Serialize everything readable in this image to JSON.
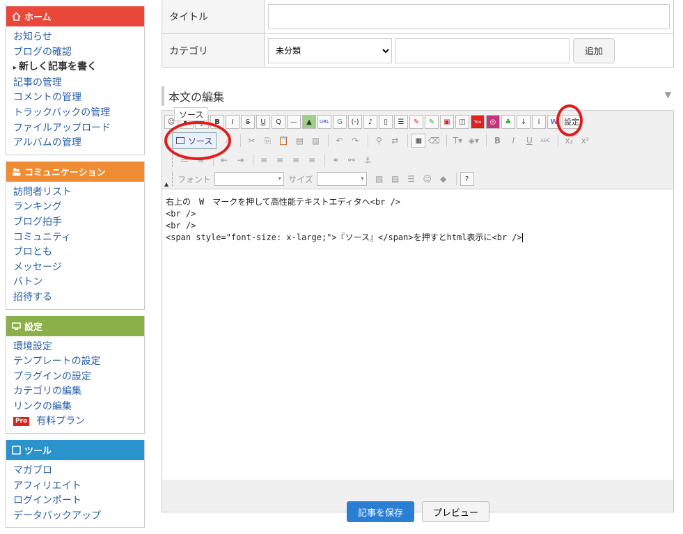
{
  "sidebar": {
    "home": {
      "title": "ホーム",
      "color": "#e8473a",
      "items": [
        "お知らせ",
        "ブログの確認",
        "新しく記事を書く",
        "記事の管理",
        "コメントの管理",
        "トラックバックの管理",
        "ファイルアップロード",
        "アルバムの管理"
      ]
    },
    "community": {
      "title": "コミュニケーション",
      "color": "#f08c34",
      "items": [
        "訪問者リスト",
        "ランキング",
        "ブログ拍手",
        "コミュニティ",
        "ブロとも",
        "メッセージ",
        "バトン",
        "招待する"
      ]
    },
    "settings": {
      "title": "設定",
      "color": "#8bb04a",
      "items": [
        "環境設定",
        "テンプレートの設定",
        "プラグインの設定",
        "カテゴリの編集",
        "リンクの編集"
      ],
      "pro_badge": "Pro",
      "pro_label": "有料プラン"
    },
    "tools": {
      "title": "ツール",
      "color": "#2b93cc",
      "items": [
        "マガブロ",
        "アフィリエイト",
        "ログインポート",
        "データバックアップ"
      ]
    }
  },
  "form": {
    "title_label": "タイトル",
    "category_label": "カテゴリ",
    "category_selected": "未分類",
    "add_button": "追加"
  },
  "editor": {
    "section_title": "本文の編集",
    "tooltip": "ソース",
    "source_button": "ソース",
    "settings_button": "設定",
    "font_label": "フォント",
    "size_label": "サイズ",
    "content_lines": [
      "右上の　W　マークを押して高性能テキストエディタへ<br />",
      "<br />",
      "<br />",
      "<span style=\"font-size: x-large;\">『ソース』</span>を押すとhtml表示に<br />"
    ]
  },
  "footer": {
    "save_button": "記事を保存",
    "preview_button": "プレビュー"
  }
}
